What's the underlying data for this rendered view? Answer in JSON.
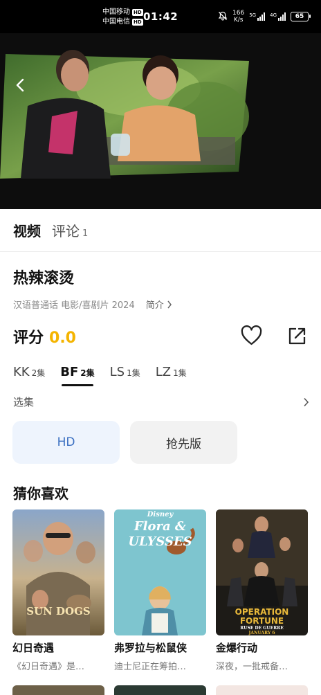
{
  "status_bar": {
    "carrier1": "中国移动",
    "carrier2": "中国电信",
    "hd_badge": "HD",
    "time": "01:42",
    "net_speed_value": "166",
    "net_speed_unit": "K/s",
    "net1": "5G",
    "net2": "4G",
    "battery": "65"
  },
  "tabs": [
    {
      "label": "视频",
      "count": ""
    },
    {
      "label": "评论",
      "count": "1"
    }
  ],
  "movie": {
    "title": "热辣滚烫",
    "meta": "汉语普通话 电影/喜剧片 2024",
    "intro_label": "简介",
    "rating_label": "评分",
    "rating_value": "0.0"
  },
  "sources": [
    {
      "name": "KK",
      "count": "2集",
      "active": false
    },
    {
      "name": "BF",
      "count": "2集",
      "active": true
    },
    {
      "name": "LS",
      "count": "1集",
      "active": false
    },
    {
      "name": "LZ",
      "count": "1集",
      "active": false
    }
  ],
  "episodes": {
    "label": "选集",
    "buttons": [
      "HD",
      "抢先版"
    ]
  },
  "recommend": {
    "title": "猜你喜欢",
    "items": [
      {
        "title": "幻日奇遇",
        "desc": "《幻日奇遇》是…",
        "poster_text": "SUN DOGS"
      },
      {
        "title": "弗罗拉与松鼠侠",
        "desc": "迪士尼正在筹拍…",
        "poster_text": "Flora & ULYSSES",
        "poster_brand": "Disney"
      },
      {
        "title": "金爆行动",
        "desc": "深夜，一批戒备…",
        "poster_text": "OPERATION FORTUNE",
        "poster_sub": "RUSE DE GUERRE",
        "poster_date": "JANUARY 6"
      }
    ]
  },
  "colors": {
    "accent_rating": "#f4b400",
    "hd_button_text": "#3a6fc1",
    "hd_button_bg": "#eef4fd"
  }
}
